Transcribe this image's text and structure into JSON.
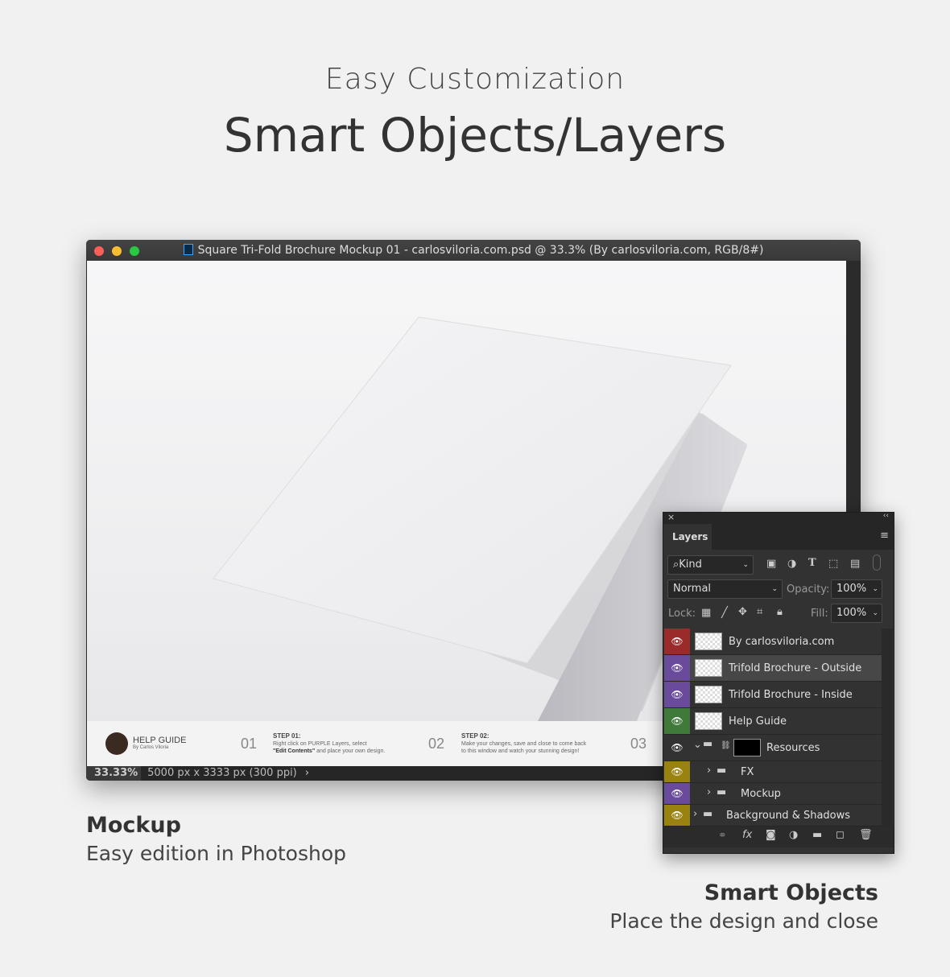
{
  "header": {
    "subtitle": "Easy Customization",
    "title": "Smart Objects/Layers"
  },
  "window": {
    "title": "Square Tri-Fold Brochure Mockup 01 - carlosviloria.com.psd @ 33.3% (By carlosviloria.com, RGB/8#)",
    "zoom": "33.33%",
    "doc_info": "5000 px x 3333 px (300 ppi)"
  },
  "help_guide": {
    "title": "HELP GUIDE",
    "author": "By Carlos Viloria",
    "steps": [
      {
        "num": "01",
        "label": "STEP 01:",
        "line1": "Right click on PURPLE Layers, select",
        "bold": "\"Edit Contents\"",
        "line2": " and place your own design."
      },
      {
        "num": "02",
        "label": "STEP 02:",
        "line1": "Make your changes, save and close to come back",
        "line2": "to this window and watch your stunning design!"
      },
      {
        "num": "03"
      }
    ]
  },
  "layers_panel": {
    "tab": "Layers",
    "filter": "Kind",
    "blend_mode": "Normal",
    "opacity_label": "Opacity:",
    "opacity": "100%",
    "lock_label": "Lock:",
    "fill_label": "Fill:",
    "fill": "100%",
    "layers": [
      {
        "name": "By carlosviloria.com",
        "color": "#9b2a2a"
      },
      {
        "name": "Trifold Brochure - Outside",
        "color": "#6a4a9a"
      },
      {
        "name": "Trifold Brochure - Inside",
        "color": "#6a4a9a"
      },
      {
        "name": "Help Guide",
        "color": "#3f7a3a"
      },
      {
        "name": "Resources",
        "color": "#323232"
      },
      {
        "name": "FX",
        "color": "#9a8210"
      },
      {
        "name": "Mockup",
        "color": "#6a4a9a"
      },
      {
        "name": "Background & Shadows",
        "color": "#9a8210"
      }
    ]
  },
  "captions": {
    "left_title": "Mockup",
    "left_text": "Easy edition in Photoshop",
    "right_title": "Smart Objects",
    "right_text": "Place the design and close"
  }
}
